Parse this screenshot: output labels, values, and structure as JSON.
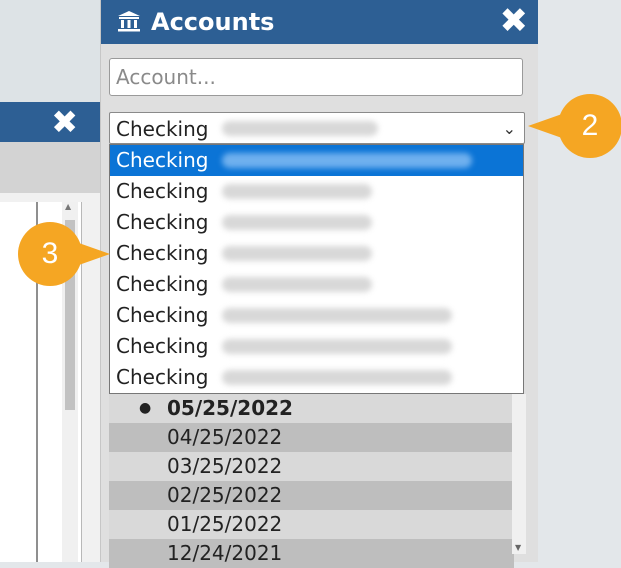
{
  "window": {
    "title": "Accounts",
    "close": "✖"
  },
  "left_window": {
    "close": "✖"
  },
  "search": {
    "placeholder": "Account..."
  },
  "account_select": {
    "value": "Checking",
    "chevron": "⌄"
  },
  "dropdown": {
    "items": [
      {
        "label": "Checking",
        "selected": true
      },
      {
        "label": "Checking",
        "selected": false
      },
      {
        "label": "Checking",
        "selected": false
      },
      {
        "label": "Checking",
        "selected": false
      },
      {
        "label": "Checking",
        "selected": false
      },
      {
        "label": "Checking",
        "selected": false
      },
      {
        "label": "Checking",
        "selected": false
      },
      {
        "label": "Checking",
        "selected": false
      }
    ]
  },
  "dates": {
    "bullet": "●",
    "rows": [
      "05/25/2022",
      "04/25/2022",
      "03/25/2022",
      "02/25/2022",
      "01/25/2022",
      "12/24/2021"
    ]
  },
  "callouts": {
    "two": "2",
    "three": "3"
  },
  "colors": {
    "titlebar": "#2d5f94",
    "selected": "#0b74d6",
    "callout": "#f5a623"
  },
  "icons": {
    "title": "bank-icon",
    "close": "close-icon",
    "chevron": "chevron-down-icon"
  }
}
